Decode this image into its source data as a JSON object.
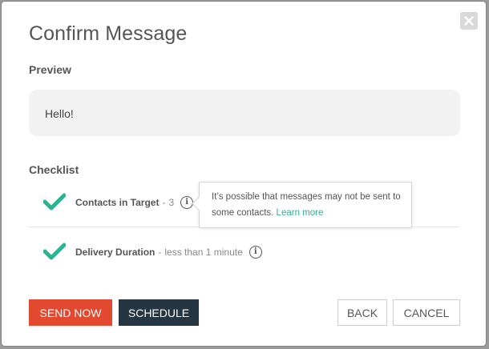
{
  "modal": {
    "title": "Confirm Message",
    "close_icon": "close-icon"
  },
  "preview": {
    "label": "Preview",
    "message": "Hello!"
  },
  "checklist": {
    "label": "Checklist",
    "items": [
      {
        "label": "Contacts in Target",
        "separator": "-",
        "value": "3",
        "icon": "checkmark-icon",
        "info_icon": "info-icon"
      },
      {
        "label": "Delivery Duration",
        "separator": "-",
        "value": "less than 1 minute",
        "icon": "checkmark-icon",
        "info_icon": "info-icon"
      }
    ]
  },
  "tooltip": {
    "text": "It’s possible that messages may not be sent to some contacts.",
    "link": "Learn more"
  },
  "buttons": {
    "send_now": "Send Now",
    "schedule": "Schedule",
    "back": "Back",
    "cancel": "Cancel"
  },
  "colors": {
    "accent_green": "#2bb394",
    "send_red": "#e2492f",
    "schedule_navy": "#253642"
  }
}
